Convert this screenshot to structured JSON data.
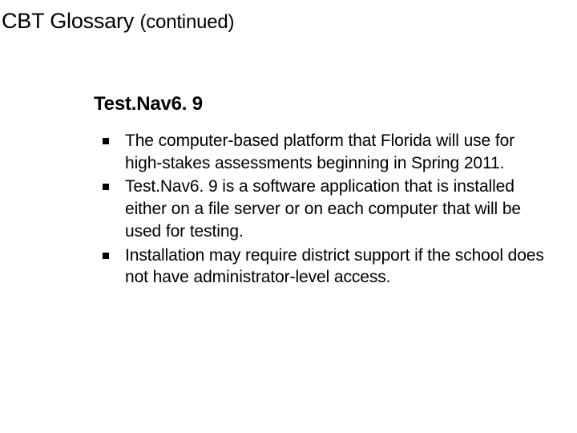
{
  "title": {
    "main": "CBT Glossary",
    "sub": "(continued)"
  },
  "subheading": "Test.Nav6. 9",
  "bullets": [
    "The computer-based platform that Florida will use for high-stakes assessments beginning in Spring 2011.",
    "Test.Nav6. 9 is a software application that is installed either on a file server or on each computer that will be used for testing.",
    "Installation may require district support if the school does not have administrator-level access."
  ]
}
